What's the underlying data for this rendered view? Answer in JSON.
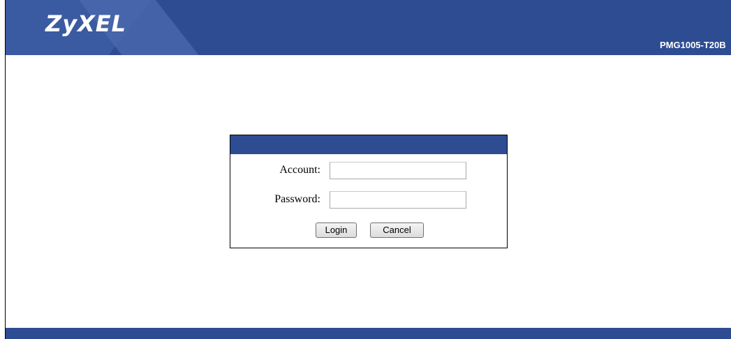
{
  "header": {
    "logo_text": "ZyXEL",
    "model": "PMG1005-T20B"
  },
  "login": {
    "account_label": "Account:",
    "account_value": "",
    "password_label": "Password:",
    "password_value": "",
    "login_button": "Login",
    "cancel_button": "Cancel"
  },
  "colors": {
    "brand_blue": "#2d4c92",
    "background": "#ffffff"
  }
}
